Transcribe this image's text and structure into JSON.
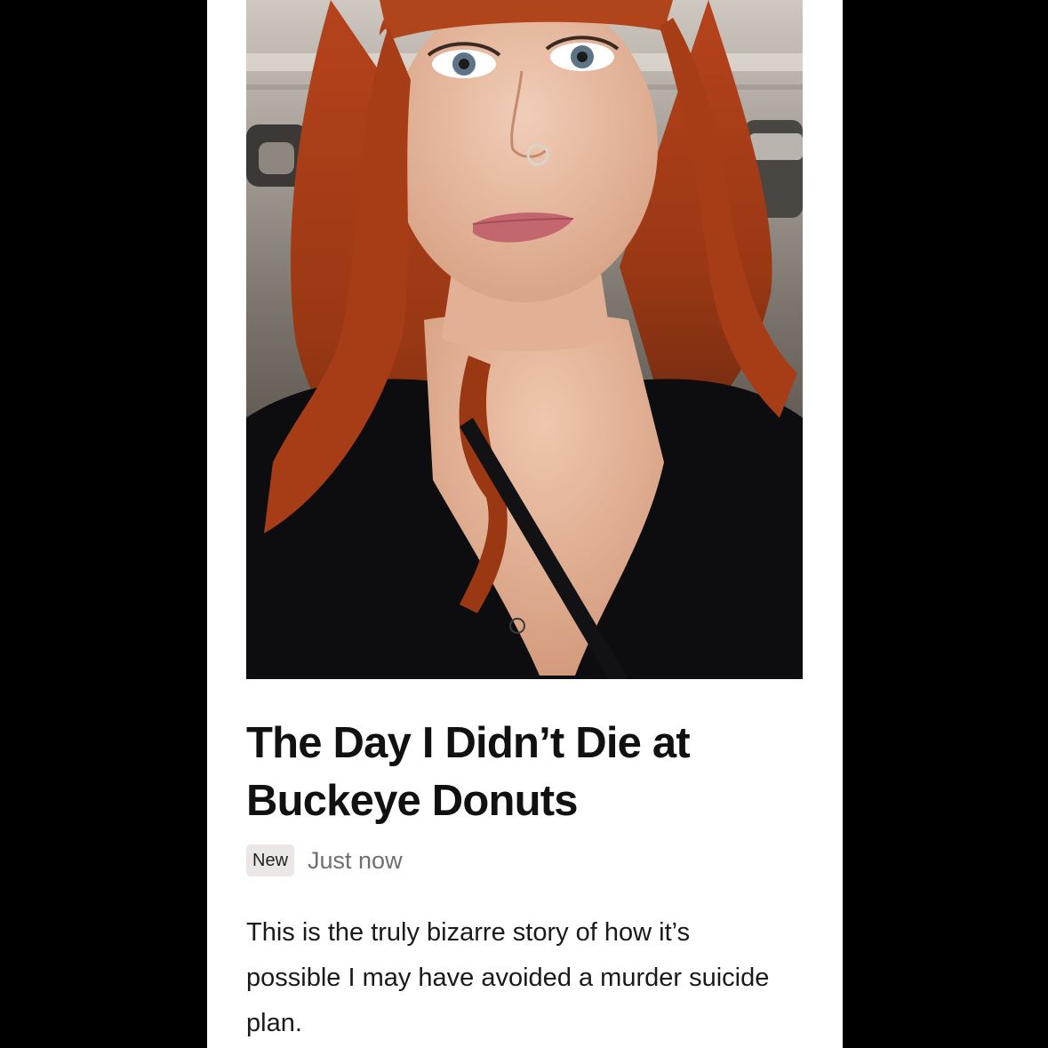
{
  "article": {
    "hero_image_label": "Selfie of a red-haired woman in a parking garage",
    "title": "The Day I Didn’t Die at Buckeye Donuts",
    "badge": "New",
    "timestamp": "Just now",
    "excerpt": "This is the truly bizarre story of how it’s possible I may have avoided a murder suicide plan."
  },
  "colors": {
    "page_background": "#000000",
    "card_background": "#ffffff",
    "badge_background": "#ece6e7",
    "timestamp_text": "#6f6f6f"
  }
}
